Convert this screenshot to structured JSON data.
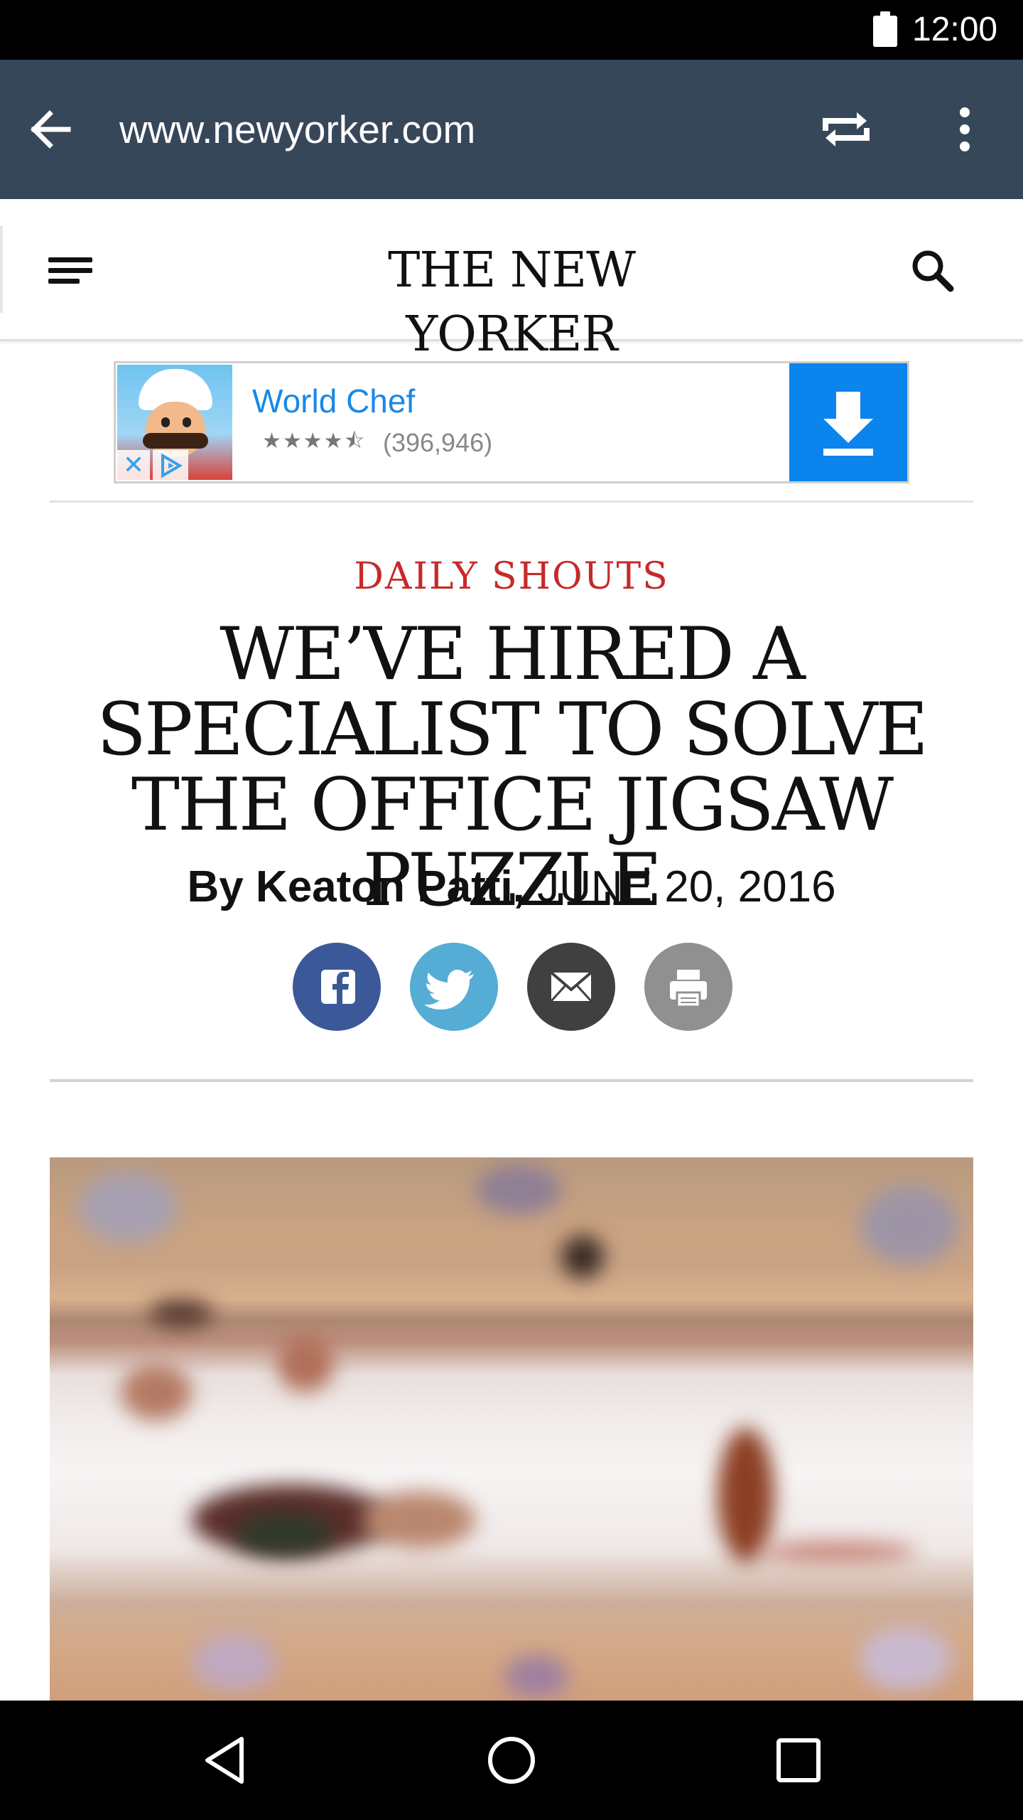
{
  "status_bar": {
    "time": "12:00",
    "battery_icon": "battery-full-icon"
  },
  "browser": {
    "back_icon": "arrow-back-icon",
    "url": "www.newyorker.com",
    "cast_icon": "repeat-icon",
    "menu_icon": "more-vertical-icon",
    "toolbar_color": "#37475a"
  },
  "site_header": {
    "menu_icon": "hamburger-icon",
    "logo_text": "THE NEW YORKER",
    "search_icon": "search-icon"
  },
  "ad": {
    "title": "World Chef",
    "stars": "★★★★⯪",
    "rating_count": "(396,946)",
    "close_glyph": "✕",
    "download_icon": "download-icon",
    "accent_color": "#0b84ee"
  },
  "article": {
    "rubric": "DAILY SHOUTS",
    "headline": "WE’VE HIRED A SPECIALIST TO SOLVE THE OFFICE JIGSAW PUZZLE",
    "byline_prefix": "By Keaton Patti,",
    "date": "JUNE 20, 2016",
    "rubric_color": "#c62a2a",
    "share": [
      {
        "name": "facebook",
        "icon": "facebook-icon",
        "color": "#3b5998"
      },
      {
        "name": "twitter",
        "icon": "twitter-icon",
        "color": "#55acd5"
      },
      {
        "name": "email",
        "icon": "email-icon",
        "color": "#404040"
      },
      {
        "name": "print",
        "icon": "print-icon",
        "color": "#909090"
      }
    ]
  },
  "nav_bar": {
    "back_icon": "nav-back-icon",
    "home_icon": "nav-home-icon",
    "recents_icon": "nav-recents-icon"
  }
}
